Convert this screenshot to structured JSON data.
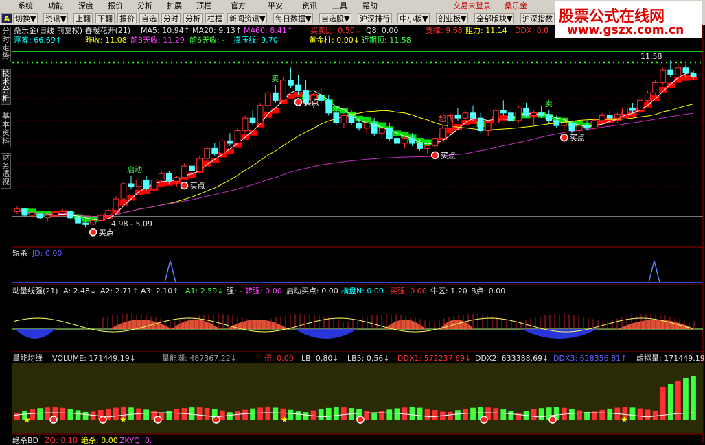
{
  "menu": {
    "items": [
      "系统",
      "功能",
      "深度",
      "报价",
      "分析",
      "扩展",
      "顶栏",
      "官方",
      "平安",
      "资讯",
      "工具",
      "帮助"
    ],
    "status": "交易未登录",
    "stock": "桑乐金"
  },
  "toolbar": {
    "buttons": [
      "切换▼",
      "资讯▼",
      "上翻",
      "下翻",
      "报价",
      "自选",
      "分时",
      "分析",
      "栏框",
      "新闻资讯▼",
      "每日数据▼",
      "自选股▼",
      "沪深排行",
      "中小板▼",
      "创业板▼",
      "全部版块▼",
      "沪深指数"
    ],
    "a_label": "A"
  },
  "logo": {
    "title": "股票公式在线网",
    "url": "www.gszx.com.cn"
  },
  "left_tabs": [
    {
      "label": "分时走势",
      "current": false
    },
    {
      "label": "技术分析",
      "current": true
    },
    {
      "label": "基本资料",
      "current": false
    },
    {
      "label": "财务透视",
      "current": false
    }
  ],
  "main_panel": {
    "row1": [
      {
        "text": "桑乐金(日线 前复权) 春暖花开(21)",
        "color": "w"
      },
      {
        "text": "MA5: 10.94↑",
        "color": "w"
      },
      {
        "text": "MA20: 9.13↑",
        "color": "w"
      },
      {
        "text": "MA60: 8.41↑",
        "color": "m"
      },
      {
        "text": "买卖比: 0.50↓",
        "color": "r"
      },
      {
        "text": "Q8: 0.00",
        "color": "w"
      },
      {
        "text": "支撑: 9.68",
        "color": "r"
      },
      {
        "text": "阻力: 11.14",
        "color": "y"
      },
      {
        "text": "DDX: 0.0",
        "color": "r"
      }
    ],
    "row2": [
      {
        "text": "浮筹: 66.69↑",
        "color": "c"
      },
      {
        "text": "昨收: 11.08",
        "color": "y"
      },
      {
        "text": "前3天收: 11.29",
        "color": "m"
      },
      {
        "text": "前6天收: -",
        "color": "g"
      },
      {
        "text": "撑压线: 9.70",
        "color": "c"
      },
      {
        "text": "黄金柱: 0.00↓",
        "color": "y"
      },
      {
        "text": "近期顶: 11.58",
        "color": "g"
      }
    ],
    "high_label": "11.58",
    "low_label": "4.98 - 5.09",
    "buy_label": "买点",
    "sell_label": "卖",
    "fly_label": "起飞",
    "start_label": "启动"
  },
  "panel_duansha": {
    "title": "短杀",
    "value": "JD: 0.00"
  },
  "panel_dongliang": {
    "items": [
      {
        "text": "动量线强(21)",
        "color": "w"
      },
      {
        "text": "A: 2.48↓",
        "color": "w"
      },
      {
        "text": "A2: 2.71↑",
        "color": "w"
      },
      {
        "text": "A3: 2.10↑",
        "color": "w"
      },
      {
        "text": "A1: 2.59↓",
        "color": "g"
      },
      {
        "text": "强: -",
        "color": "w"
      },
      {
        "text": "转强: 0.00",
        "color": "m"
      },
      {
        "text": "启动买点: 0.00",
        "color": "w"
      },
      {
        "text": "横盘N: 0.00",
        "color": "c"
      },
      {
        "text": "买强: 0.00",
        "color": "r"
      },
      {
        "text": "牛区: 1.20",
        "color": "w"
      },
      {
        "text": "B点: 0.00",
        "color": "w"
      }
    ]
  },
  "panel_volume": {
    "items": [
      {
        "text": "量能均线",
        "color": "w"
      },
      {
        "text": "VOLUME: 171449.19↓",
        "color": "w"
      },
      {
        "text": "量能潮: 487367.22↓",
        "color": "gr"
      },
      {
        "text": "倍: 0.00",
        "color": "r"
      },
      {
        "text": "LB: 0.80↓",
        "color": "w"
      },
      {
        "text": "LB5: 0.56↓",
        "color": "w"
      },
      {
        "text": "DDX1: 572237.69↓",
        "color": "r"
      },
      {
        "text": "DDX2: 633388.69↓",
        "color": "w"
      },
      {
        "text": "DDX3: 628356.81↑",
        "color": "b"
      },
      {
        "text": "虚拟量: 171449.19",
        "color": "w"
      }
    ]
  },
  "panel_bottom": {
    "items": [
      {
        "text": "绝杀BD",
        "color": "w"
      },
      {
        "text": "ZQ: 0.18",
        "color": "r"
      },
      {
        "text": "绝杀: 0.00",
        "color": "y"
      },
      {
        "text": "ZKYQ: 0.",
        "color": "m"
      }
    ]
  },
  "chart_data": {
    "type": "candlestick",
    "candles_ohlc": [
      [
        5.6,
        5.8,
        5.5,
        5.7
      ],
      [
        5.7,
        5.75,
        5.4,
        5.45
      ],
      [
        5.45,
        5.6,
        5.35,
        5.55
      ],
      [
        5.5,
        5.55,
        5.3,
        5.35
      ],
      [
        5.35,
        5.5,
        5.2,
        5.45
      ],
      [
        5.45,
        5.6,
        5.4,
        5.55
      ],
      [
        5.55,
        5.7,
        5.5,
        5.6
      ],
      [
        5.6,
        5.65,
        5.3,
        5.35
      ],
      [
        5.35,
        5.4,
        5.1,
        5.15
      ],
      [
        5.15,
        5.25,
        4.98,
        5.09
      ],
      [
        5.1,
        5.3,
        5.05,
        5.25
      ],
      [
        5.25,
        5.5,
        5.2,
        5.45
      ],
      [
        5.45,
        5.7,
        5.4,
        5.65
      ],
      [
        5.65,
        6.2,
        5.6,
        6.1
      ],
      [
        6.1,
        6.8,
        6.0,
        6.7
      ],
      [
        6.7,
        7.0,
        6.5,
        6.6
      ],
      [
        6.6,
        6.9,
        6.5,
        6.85
      ],
      [
        6.85,
        7.0,
        6.4,
        6.5
      ],
      [
        6.5,
        6.9,
        6.45,
        6.85
      ],
      [
        6.85,
        7.2,
        6.8,
        7.1
      ],
      [
        7.1,
        7.2,
        6.7,
        6.8
      ],
      [
        6.8,
        7.0,
        6.6,
        6.95
      ],
      [
        6.95,
        7.5,
        6.9,
        7.4
      ],
      [
        7.4,
        7.6,
        7.1,
        7.2
      ],
      [
        7.2,
        7.8,
        7.1,
        7.7
      ],
      [
        7.7,
        8.2,
        7.6,
        8.1
      ],
      [
        8.1,
        8.3,
        7.8,
        7.9
      ],
      [
        7.9,
        8.5,
        7.85,
        8.4
      ],
      [
        8.4,
        8.7,
        8.2,
        8.3
      ],
      [
        8.3,
        8.9,
        8.2,
        8.8
      ],
      [
        8.8,
        9.4,
        8.7,
        9.3
      ],
      [
        9.3,
        9.6,
        9.0,
        9.1
      ],
      [
        9.1,
        9.9,
        9.05,
        9.8
      ],
      [
        9.8,
        10.4,
        9.7,
        10.3
      ],
      [
        10.3,
        10.6,
        9.9,
        10.0
      ],
      [
        10.0,
        10.9,
        9.95,
        10.8
      ],
      [
        10.8,
        11.3,
        10.5,
        10.6
      ],
      [
        10.6,
        11.0,
        10.2,
        10.4
      ],
      [
        10.4,
        10.8,
        9.8,
        9.9
      ],
      [
        9.9,
        10.3,
        9.7,
        10.2
      ],
      [
        10.2,
        10.5,
        9.9,
        10.0
      ],
      [
        10.0,
        10.2,
        9.4,
        9.5
      ],
      [
        9.5,
        9.7,
        9.0,
        9.1
      ],
      [
        9.1,
        9.5,
        8.9,
        9.4
      ],
      [
        9.4,
        9.6,
        9.0,
        9.1
      ],
      [
        9.1,
        9.3,
        8.8,
        8.9
      ],
      [
        8.9,
        9.2,
        8.7,
        9.1
      ],
      [
        9.1,
        9.3,
        8.6,
        8.7
      ],
      [
        8.7,
        9.0,
        8.5,
        8.9
      ],
      [
        8.9,
        9.1,
        8.4,
        8.5
      ],
      [
        8.5,
        8.7,
        8.2,
        8.3
      ],
      [
        8.3,
        8.6,
        8.1,
        8.5
      ],
      [
        8.5,
        8.7,
        8.2,
        8.3
      ],
      [
        8.3,
        8.5,
        8.0,
        8.1
      ],
      [
        8.1,
        8.3,
        7.9,
        8.2
      ],
      [
        8.2,
        8.6,
        8.1,
        8.5
      ],
      [
        8.5,
        9.0,
        8.4,
        8.9
      ],
      [
        8.9,
        9.5,
        8.8,
        9.4
      ],
      [
        9.4,
        9.7,
        9.2,
        9.3
      ],
      [
        9.3,
        9.6,
        9.1,
        9.5
      ],
      [
        9.5,
        9.8,
        9.2,
        9.3
      ],
      [
        9.3,
        9.5,
        8.7,
        8.8
      ],
      [
        8.8,
        9.2,
        8.6,
        9.1
      ],
      [
        9.1,
        9.7,
        9.0,
        9.6
      ],
      [
        9.6,
        10.0,
        9.4,
        9.5
      ],
      [
        9.5,
        9.8,
        9.1,
        9.2
      ],
      [
        9.2,
        9.8,
        9.1,
        9.7
      ],
      [
        9.7,
        9.9,
        9.3,
        9.4
      ],
      [
        9.4,
        9.6,
        9.0,
        9.5
      ],
      [
        9.5,
        9.8,
        9.3,
        9.4
      ],
      [
        9.4,
        9.6,
        9.1,
        9.2
      ],
      [
        9.2,
        9.4,
        8.9,
        9.0
      ],
      [
        9.0,
        9.3,
        8.8,
        9.1
      ],
      [
        9.1,
        9.2,
        8.7,
        8.8
      ],
      [
        8.8,
        9.1,
        8.7,
        9.0
      ],
      [
        9.0,
        9.2,
        8.8,
        8.9
      ],
      [
        8.9,
        9.3,
        8.85,
        9.2
      ],
      [
        9.2,
        9.5,
        9.1,
        9.4
      ],
      [
        9.4,
        9.6,
        9.2,
        9.3
      ],
      [
        9.3,
        9.5,
        9.1,
        9.45
      ],
      [
        9.45,
        9.8,
        9.4,
        9.7
      ],
      [
        9.7,
        9.9,
        9.5,
        9.6
      ],
      [
        9.6,
        10.1,
        9.55,
        10.0
      ],
      [
        10.0,
        10.4,
        9.9,
        10.3
      ],
      [
        10.3,
        10.8,
        10.2,
        10.7
      ],
      [
        10.7,
        11.3,
        10.6,
        11.2
      ],
      [
        11.2,
        11.58,
        10.9,
        11.0
      ],
      [
        11.0,
        11.5,
        10.8,
        11.29
      ],
      [
        11.29,
        11.4,
        10.9,
        11.08
      ],
      [
        11.08,
        11.2,
        10.8,
        10.94
      ]
    ],
    "ma5_label": "MA5",
    "ma20_label": "MA20",
    "ma60_label": "MA60",
    "ylim": [
      4.8,
      11.8
    ]
  }
}
